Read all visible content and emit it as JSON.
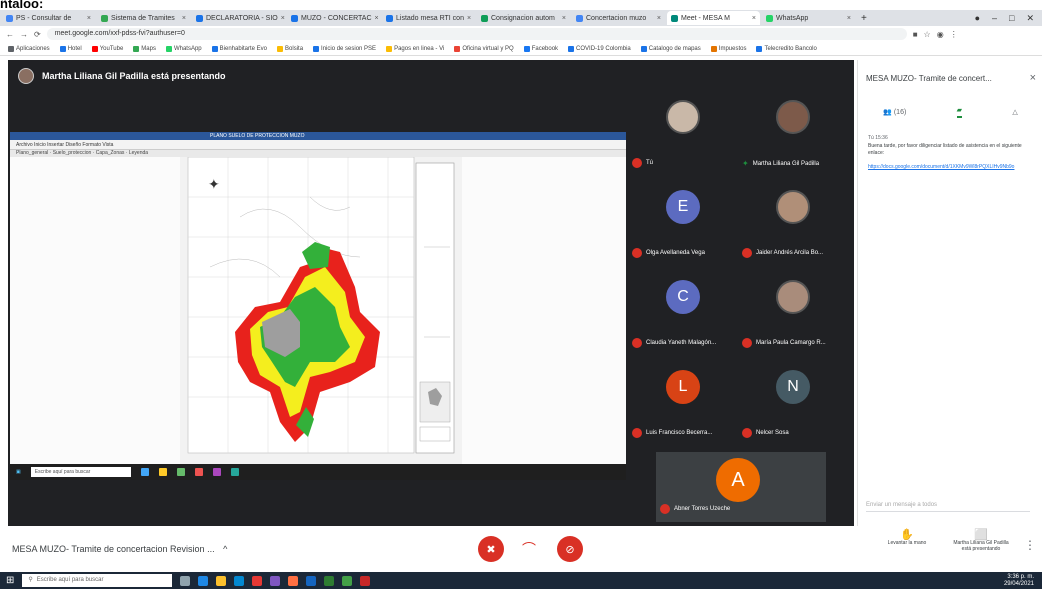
{
  "browser": {
    "tabs": [
      {
        "label": "PS - Consultar de",
        "color": "#4285f4"
      },
      {
        "label": "Sistema de Tramites",
        "color": "#34a853"
      },
      {
        "label": "DECLARATORIA - SIO",
        "color": "#1a73e8"
      },
      {
        "label": "MUZO - CONCERTAC",
        "color": "#1a73e8"
      },
      {
        "label": "Listado mesa RTI con",
        "color": "#1a73e8"
      },
      {
        "label": "Consignacion autom",
        "color": "#0f9d58"
      },
      {
        "label": "Concertacion muzo",
        "color": "#4285f4"
      },
      {
        "label": "Meet - MESA M",
        "color": "#00897b",
        "active": true
      },
      {
        "label": "WhatsApp",
        "color": "#25d366"
      }
    ],
    "url": "meet.google.com/xxf-pdss-fvi?authuser=0",
    "bookmarks": [
      {
        "label": "Aplicaciones",
        "color": "#5f6368"
      },
      {
        "label": "Hotel",
        "color": "#1a73e8"
      },
      {
        "label": "YouTube",
        "color": "#ff0000"
      },
      {
        "label": "Maps",
        "color": "#34a853"
      },
      {
        "label": "WhatsApp",
        "color": "#25d366"
      },
      {
        "label": "Bienhabitarte Evo",
        "color": "#1a73e8"
      },
      {
        "label": "Bolsita",
        "color": "#fbbc04"
      },
      {
        "label": "Inicio de sesion PSE",
        "color": "#1a73e8"
      },
      {
        "label": "Pagos en linea - Vi",
        "color": "#fbbc04"
      },
      {
        "label": "Oficina virtual y PQ",
        "color": "#ea4335"
      },
      {
        "label": "Facebook",
        "color": "#1877f2"
      },
      {
        "label": "COVID-19 Colombia",
        "color": "#1a73e8"
      },
      {
        "label": "Catalogo de mapas",
        "color": "#1a73e8"
      },
      {
        "label": "Impuestos",
        "color": "#e37400"
      },
      {
        "label": "Telecredito Bancolo",
        "color": "#1a73e8"
      }
    ]
  },
  "meet": {
    "presenter_banner": "Martha Liliana Gil Padilla está presentando",
    "participants": [
      {
        "name": "Tú",
        "initial": "",
        "photo": true,
        "color": "#c9b8a8",
        "muted": true
      },
      {
        "name": "Martha Liliana Gil Padilla",
        "initial": "",
        "photo": true,
        "color": "#7d5a4a",
        "muted": false
      },
      {
        "name": "Olga Avellaneda Vega",
        "initial": "E",
        "photo": false,
        "color": "#5c6bc0",
        "muted": true
      },
      {
        "name": "Jaider Andrés Arcila Bo...",
        "initial": "",
        "photo": true,
        "color": "#b08f78",
        "muted": true
      },
      {
        "name": "Claudia Yaneth Malagón...",
        "initial": "C",
        "photo": false,
        "color": "#5c6bc0",
        "muted": true
      },
      {
        "name": "María Paula Camargo R...",
        "initial": "",
        "photo": true,
        "color": "#a98c7b",
        "muted": true
      },
      {
        "name": "Luis Francisco Becerra...",
        "initial": "L",
        "photo": false,
        "color": "#d84315",
        "muted": true
      },
      {
        "name": "Nelcer Sosa",
        "initial": "N",
        "photo": false,
        "color": "#455a64",
        "muted": true
      },
      {
        "name": "Abner Torres Uzeche",
        "initial": "A",
        "photo": false,
        "color": "#ef6c00",
        "muted": true
      }
    ],
    "meeting_name": "MESA MUZO- Tramite de concertacion Revision ...",
    "chevron": "^",
    "controls": {
      "mic_icon": "mic-off-icon",
      "more_icon": "more-icon",
      "cam_icon": "camera-off-icon"
    },
    "right_controls": [
      {
        "label": "Levantar la mano",
        "icon": "hand-icon",
        "glyph": "✋"
      },
      {
        "label": "Martha Liliana Gil Padilla está presentando",
        "icon": "present-icon",
        "glyph": "⬜"
      }
    ]
  },
  "chat_panel": {
    "title": "MESA MUZO- Tramite de concert...",
    "close": "×",
    "tabs": [
      {
        "label": "(16)",
        "icon": "people-icon"
      },
      {
        "label": "",
        "icon": "chat-icon",
        "active": true
      },
      {
        "label": "",
        "icon": "activities-icon"
      }
    ],
    "message_meta": "Tú  15:36",
    "message_text": "Buena tarde, por favor diligenciar listado de asistencia en el siguiente enlace:",
    "message_link": "https://docs.google.com/document/d/1XKMv9Wl8rPQXLIHv9Nb9o",
    "input_placeholder": "Enviar un mensaje a todos"
  },
  "shared_screen": {
    "window_title": "PLANO SUELO DE PROTECCION MUZO",
    "ribbon": "Archivo  Inicio  Insertar  Diseño  Formato  Vista",
    "tabs": "Plano_general  ·  Suelo_proteccion  ·  Capa_Zonas  ·  Leyenda"
  },
  "windows": {
    "search_placeholder": "Escribe aquí para buscar",
    "time": "3:36 p. m.",
    "date": "29/04/2021"
  }
}
